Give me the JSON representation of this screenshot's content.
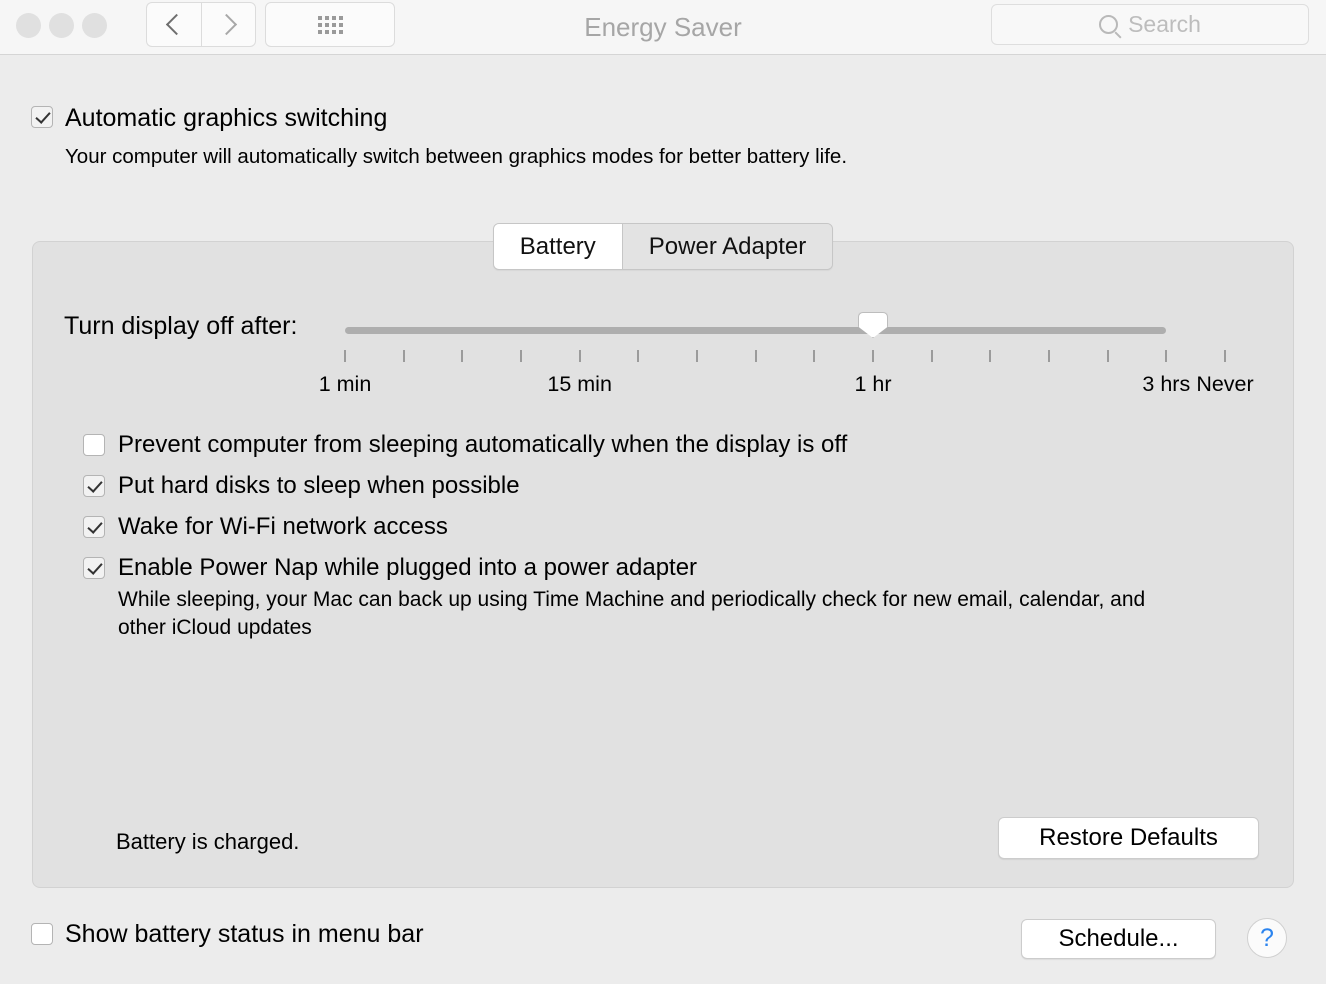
{
  "window": {
    "title": "Energy Saver",
    "traffic_lights": [
      "close",
      "minimize",
      "zoom"
    ],
    "nav": {
      "back_label": "Back",
      "forward_label": "Forward",
      "show_all_label": "Show All"
    },
    "search": {
      "placeholder": "Search",
      "value": ""
    }
  },
  "graphics": {
    "checkbox_label": "Automatic graphics switching",
    "checked": true,
    "description": "Your computer will automatically switch between graphics modes for better battery life."
  },
  "tabs": [
    {
      "label": "Battery",
      "active": true
    },
    {
      "label": "Power Adapter",
      "active": false
    }
  ],
  "slider": {
    "label": "Turn display off after:",
    "value_label": "1 hr",
    "tick_count": 16,
    "thumb_tick_index": 9,
    "track_end_tick_index": 14,
    "tick_labels": [
      {
        "text": "1 min",
        "tick_index": 0
      },
      {
        "text": "15 min",
        "tick_index": 4
      },
      {
        "text": "1 hr",
        "tick_index": 9
      },
      {
        "text": "3 hrs",
        "tick_index": 14
      },
      {
        "text": "Never",
        "tick_index": 15
      }
    ]
  },
  "options": [
    {
      "label": "Prevent computer from sleeping automatically when the display is off",
      "checked": false
    },
    {
      "label": "Put hard disks to sleep when possible",
      "checked": true
    },
    {
      "label": "Wake for Wi-Fi network access",
      "checked": true
    },
    {
      "label": "Enable Power Nap while plugged into a power adapter",
      "checked": true
    }
  ],
  "power_nap_description": "While sleeping, your Mac can back up using Time Machine and periodically check for new email, calendar, and other iCloud updates",
  "status": {
    "text": "Battery is charged."
  },
  "buttons": {
    "restore_defaults": "Restore Defaults",
    "schedule": "Schedule...",
    "help": "?"
  },
  "menu_bar_option": {
    "label": "Show battery status in menu bar",
    "checked": false
  },
  "colors": {
    "window_background": "#ececec",
    "toolbar_background": "#f6f6f6",
    "panel_background": "#e1e1e1",
    "title_text": "#a6a6a6",
    "accent_help": "#2b84ef",
    "slider_track": "#aeaeae"
  }
}
